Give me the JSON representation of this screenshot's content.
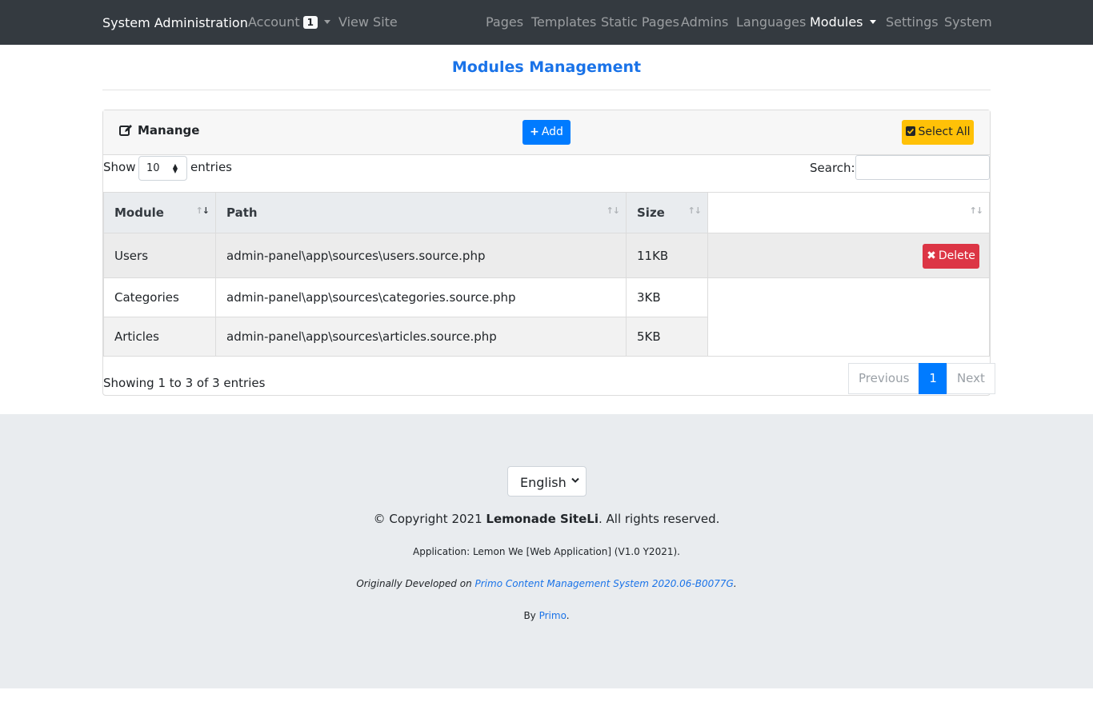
{
  "navbar": {
    "brand": "System Administration",
    "account_label": "Account",
    "account_badge": "1",
    "view_site": "View Site",
    "items": [
      "Pages",
      "Templates",
      "Static Pages",
      "Admins",
      "Languages",
      "Modules",
      "Settings",
      "System"
    ],
    "active": "Modules"
  },
  "page": {
    "title": "Modules Management"
  },
  "card": {
    "header_title": "Manange",
    "add_label": "Add",
    "select_all_label": "Select All"
  },
  "datatable": {
    "show_label": "Show",
    "page_length": "10",
    "entries_label": "entries",
    "search_label": "Search:",
    "search_value": "",
    "columns": [
      "Module",
      "Path",
      "Size",
      ""
    ],
    "rows": [
      {
        "module": "Users",
        "path": "admin-panel\\app\\sources\\users.source.php",
        "size": "11KB",
        "action": "Delete"
      },
      {
        "module": "Categories",
        "path": "admin-panel\\app\\sources\\categories.source.php",
        "size": "3KB"
      },
      {
        "module": "Articles",
        "path": "admin-panel\\app\\sources\\articles.source.php",
        "size": "5KB"
      }
    ],
    "info": "Showing 1 to 3 of 3 entries",
    "pagination": {
      "previous": "Previous",
      "current": "1",
      "next": "Next"
    }
  },
  "footer": {
    "language": "English",
    "copyright_prefix": "© Copyright 2021 ",
    "copyright_brand": "Lemonade SiteLi",
    "copyright_suffix": ". All rights reserved.",
    "application": "Application: Lemon We [Web Application] (V1.0 Y2021).",
    "developed_prefix": "Originally Developed on ",
    "developed_link": "Primo Content Management System 2020.06-B0077G",
    "developed_suffix": ".",
    "by_prefix": "By ",
    "by_link": "Primo",
    "by_suffix": "."
  },
  "colors": {
    "navbar": "#343a40",
    "primary": "#007bff",
    "warning": "#ffc107",
    "danger": "#dc3545",
    "footer": "#e9ecef"
  }
}
